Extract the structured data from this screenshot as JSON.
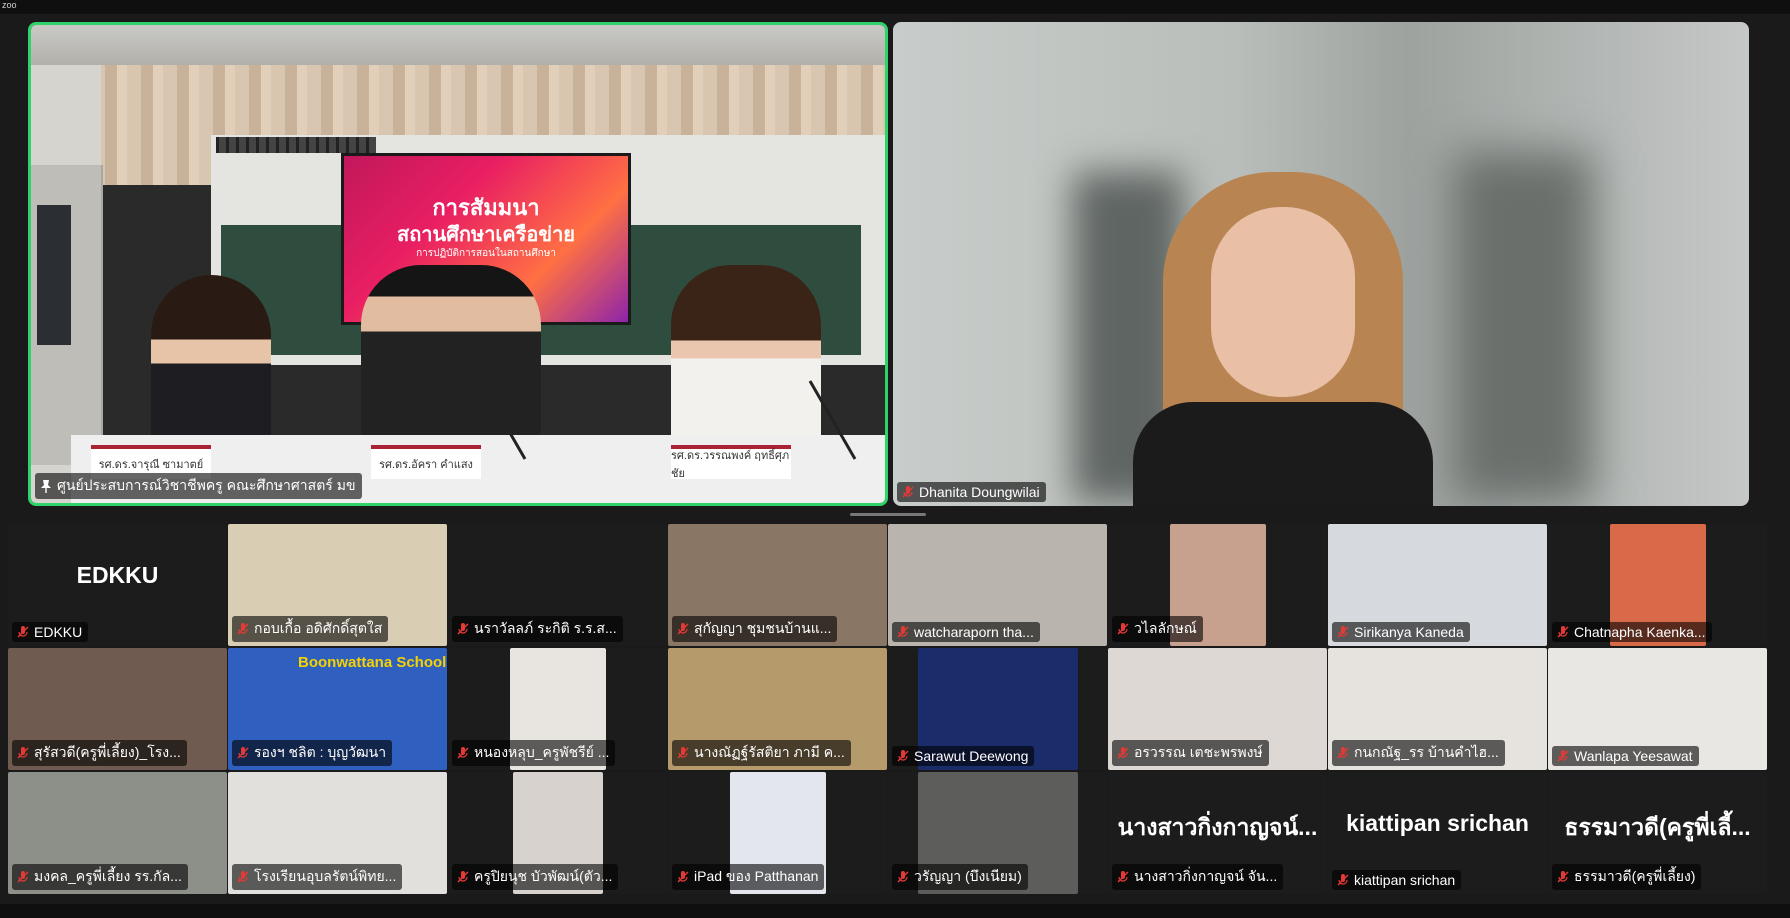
{
  "top_indicator": "zoo",
  "speakers": [
    {
      "name": "ศูนย์ประสบการณ์วิชาชีพครู คณะศึกษาศาสตร์ มข",
      "mic": "pinned",
      "active": true,
      "slide_title_1": "การสัมมนา",
      "slide_title_2": "สถานศึกษาเครือข่าย",
      "slide_subtitle": "การปฏิบัติการสอนในสถานศึกษา",
      "nameplates": [
        "รศ.ดร.จารุณี ซามาตย์",
        "รศ.ดร.อัครา คำแสง",
        "รศ.ดร.วรรณพงค์ ฤทธิ์ศุภชัย"
      ]
    },
    {
      "name": "Dhanita Doungwilai",
      "mic": "muted",
      "active": false
    }
  ],
  "gallery": [
    {
      "name": "EDKKU",
      "big": "EDKKU",
      "bg": "#1c1c1c",
      "video": null
    },
    {
      "name": "กอบเกื้อ อดิศักดิ์สุตใส",
      "video": "#d9cdb4"
    },
    {
      "name": "นราวัลลภ์ ระกิติ ร.ร.ส...",
      "video": null
    },
    {
      "name": "สุกัญญา ชุมชนบ้านแ...",
      "video": "#8a7664"
    },
    {
      "name": "watcharaporn tha...",
      "video": "#b9b4ad"
    },
    {
      "name": "วไลลักษณ์",
      "video": "#c7a08e"
    },
    {
      "name": "Sirikanya Kaneda",
      "video": "#d6d9de"
    },
    {
      "name": "Chatnapha Kaenka...",
      "video": "#d86a4a"
    },
    {
      "name": "สุรัสวดี(ครูพี่เลี้ยง)_โรง...",
      "video": "#6f5b4f"
    },
    {
      "name": "รองฯ ชลิต : บุญวัฒนา",
      "video": "#2f5fbf",
      "school": "Boonwattana School"
    },
    {
      "name": "หนองหลุบ_ครูพัชรีย์ ...",
      "video": "#e8e4e0"
    },
    {
      "name": "นางณัฏฐ์รัสติยา ภามี ค...",
      "video": "#b59a6c"
    },
    {
      "name": "Sarawut Deewong",
      "video": "#1b2c6b"
    },
    {
      "name": "อรวรรณ เตชะพรพงษ์",
      "video": "#ddd8d3"
    },
    {
      "name": "กนกณัฐ_รร บ้านคำไฮ...",
      "video": "#e6e2de"
    },
    {
      "name": "Wanlapa Yeesawat",
      "video": "#e9e7e4"
    },
    {
      "name": "มงคล_ครูพี่เลี้ยง รร.กัล...",
      "video": "#8d8f89"
    },
    {
      "name": "โรงเรียนอุบลรัตน์พิทย...",
      "video": "#e2e0dc"
    },
    {
      "name": "ครูปิยนุช บัวพัฒน์(ตัว...",
      "video": "#d7d2cd"
    },
    {
      "name": "iPad ของ Patthanan",
      "video": "#e4e6ee"
    },
    {
      "name": "วรัญญา (บึงเนียม)",
      "video": "#5d5d5b"
    },
    {
      "name": "นางสาวกิ่งกาญจน์ จัน...",
      "big": "นางสาวกิ่งกาญจน์...",
      "video": null
    },
    {
      "name": "kiattipan srichan",
      "big": "kiattipan srichan",
      "video": null
    },
    {
      "name": "ธรรมาวดี(ครูพี่เลี้ยง)",
      "big": "ธรรมาวดี(ครูพี่เลี้...",
      "video": null
    }
  ]
}
